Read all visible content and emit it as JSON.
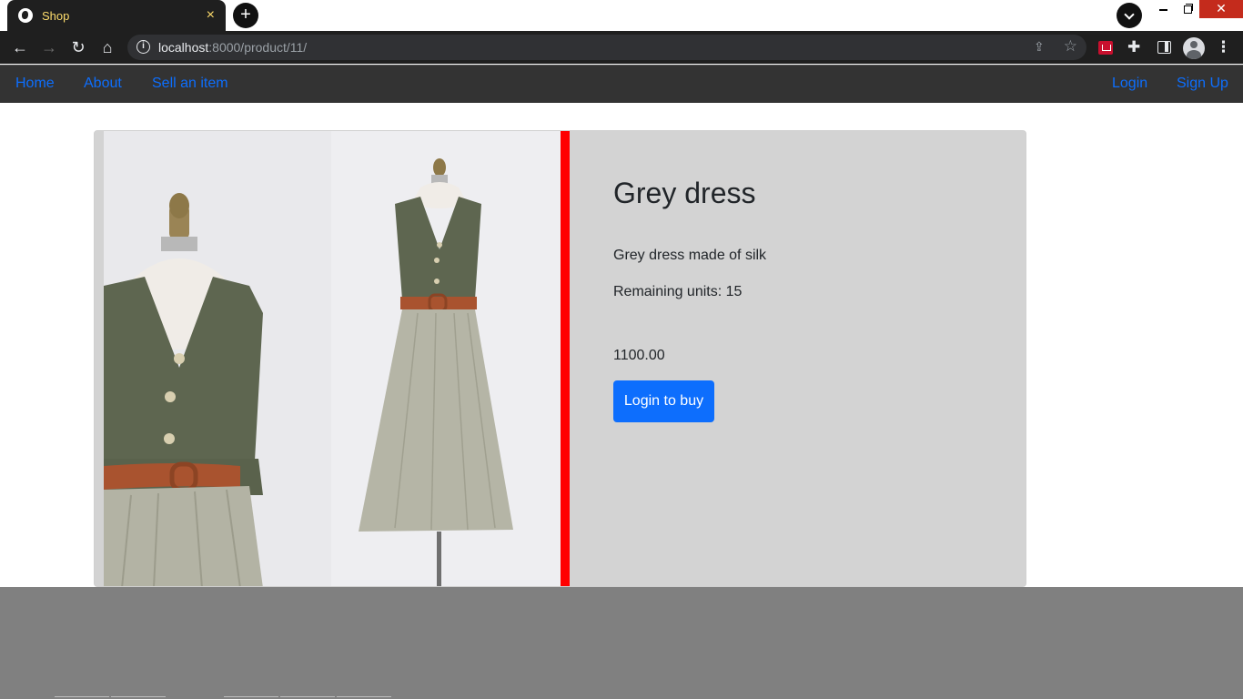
{
  "browser": {
    "tab_title": "Shop",
    "tab_close": "×",
    "new_tab": "+",
    "url_host": "localhost",
    "url_rest": ":8000/product/11/",
    "window_close": "✕"
  },
  "navbar": {
    "home": "Home",
    "about": "About",
    "sell": "Sell an item",
    "login": "Login",
    "signup": "Sign Up",
    "link_color": "#0d6efd",
    "background": "#333333"
  },
  "product": {
    "title": "Grey dress",
    "description": "Grey dress made of silk",
    "units_label": "Remaining units: ",
    "units_value": "15",
    "price": "1100.00",
    "buy_label": "Login to buy",
    "accent_bar_color": "#ff0000",
    "card_background": "#d3d3d3",
    "button_color": "#0d6efd"
  }
}
